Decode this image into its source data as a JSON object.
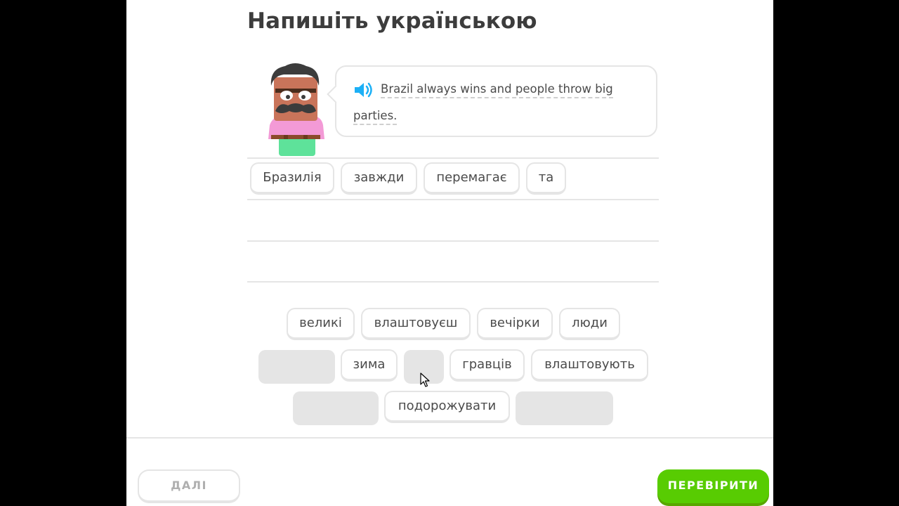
{
  "header": {
    "title": "Напишіть українською"
  },
  "prompt": {
    "line1": "Brazil always wins and people throw big",
    "line2": "parties."
  },
  "answer_chips": [
    {
      "label": "Бразилія"
    },
    {
      "label": "завжди"
    },
    {
      "label": "перемагає"
    },
    {
      "label": "та"
    }
  ],
  "word_bank": [
    {
      "label": "великі"
    },
    {
      "label": "влаштовуєш"
    },
    {
      "label": "вечірки"
    },
    {
      "label": "люди"
    },
    {
      "label": "зима"
    },
    {
      "label": "гравців"
    },
    {
      "label": "влаштовують"
    },
    {
      "label": "подорожувати"
    }
  ],
  "footer": {
    "skip_label": "ДАЛІ",
    "check_label": "ПЕРЕВІРИТИ"
  },
  "colors": {
    "accent": "#58cc02",
    "speaker": "#1cb0f6",
    "border": "#e5e5e5",
    "text": "#4b4b4b"
  },
  "icons": {
    "speaker": "speaker-icon",
    "cursor": "mouse-cursor-icon"
  }
}
